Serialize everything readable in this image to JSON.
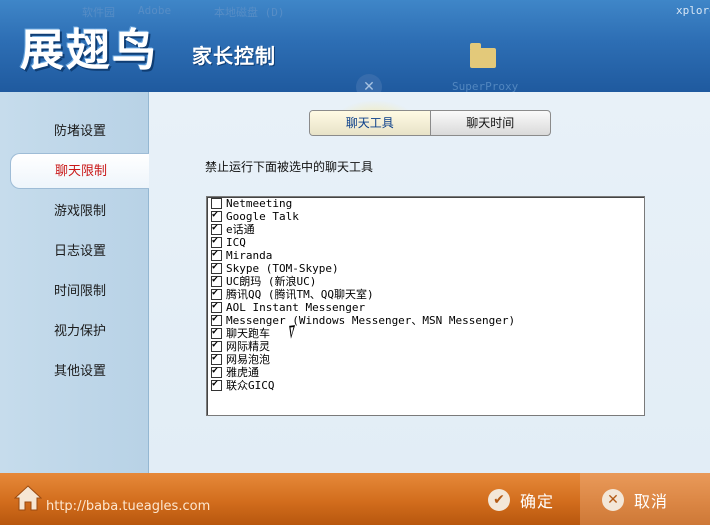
{
  "header": {
    "logo": "展翅鸟",
    "subtitle": "家长控制",
    "desktop_bg_texts": [
      "软件园",
      "Adobe",
      "本地磁盘 (D)",
      "xplore",
      "SuperProxy"
    ]
  },
  "sidebar": {
    "items": [
      {
        "label": "防堵设置",
        "active": false
      },
      {
        "label": "聊天限制",
        "active": true
      },
      {
        "label": "游戏限制",
        "active": false
      },
      {
        "label": "日志设置",
        "active": false
      },
      {
        "label": "时间限制",
        "active": false
      },
      {
        "label": "视力保护",
        "active": false
      },
      {
        "label": "其他设置",
        "active": false
      }
    ]
  },
  "tabs": [
    {
      "label": "聊天工具",
      "active": true
    },
    {
      "label": "聊天时间",
      "active": false
    }
  ],
  "main": {
    "instruction": "禁止运行下面被选中的聊天工具",
    "apps": [
      {
        "name": "Netmeeting",
        "checked": false
      },
      {
        "name": "Google Talk",
        "checked": true
      },
      {
        "name": "e话通",
        "checked": true
      },
      {
        "name": "ICQ",
        "checked": true
      },
      {
        "name": "Miranda",
        "checked": true
      },
      {
        "name": "Skype (TOM-Skype)",
        "checked": true
      },
      {
        "name": "UC朗玛 (新浪UC)",
        "checked": true
      },
      {
        "name": "腾讯QQ (腾讯TM、QQ聊天室)",
        "checked": true
      },
      {
        "name": "AOL Instant Messenger",
        "checked": true
      },
      {
        "name": "Messenger (Windows Messenger、MSN Messenger)",
        "checked": true
      },
      {
        "name": "聊天跑车",
        "checked": true
      },
      {
        "name": "网际精灵",
        "checked": true
      },
      {
        "name": "网易泡泡",
        "checked": true
      },
      {
        "name": "雅虎通",
        "checked": true
      },
      {
        "name": "联众GICQ",
        "checked": true
      }
    ]
  },
  "footer": {
    "url": "http://baba.tueagles.com",
    "ok_label": "确定",
    "cancel_label": "取消"
  },
  "colors": {
    "header_blue": "#2d6eb4",
    "footer_orange": "#d26d1d",
    "active_nav_text": "#c91818"
  }
}
